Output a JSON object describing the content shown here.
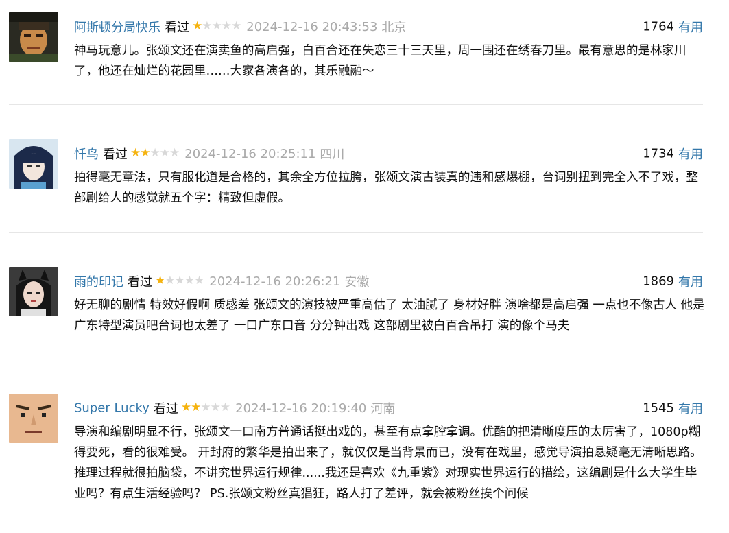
{
  "comments": [
    {
      "username": "阿斯顿分局快乐",
      "status": "看过",
      "rating": 1,
      "time": "2024-12-16 20:43:53",
      "location": "北京",
      "votes": "1764",
      "vote_label": "有用",
      "text": "神马玩意儿。张颂文还在演卖鱼的高启强，白百合还在失恋三十三天里，周一围还在绣春刀里。最有意思的是林家川了，他还在灿烂的花园里……大家各演各的，其乐融融～"
    },
    {
      "username": "忏鸟",
      "status": "看过",
      "rating": 2,
      "time": "2024-12-16 20:25:11",
      "location": "四川",
      "votes": "1734",
      "vote_label": "有用",
      "text": "拍得毫无章法，只有服化道是合格的，其余全方位拉胯，张颂文演古装真的违和感爆棚，台词别扭到完全入不了戏，整部剧给人的感觉就五个字：精致但虚假。"
    },
    {
      "username": "雨的印记",
      "status": "看过",
      "rating": 1,
      "time": "2024-12-16 20:26:21",
      "location": "安徽",
      "votes": "1869",
      "vote_label": "有用",
      "text": "好无聊的剧情 特效好假啊 质感差 张颂文的演技被严重高估了 太油腻了 身材好胖 演啥都是高启强 一点也不像古人 他是广东特型演员吧台词也太差了 一口广东口音 分分钟出戏 这部剧里被白百合吊打 演的像个马夫"
    },
    {
      "username": "Super Lucky",
      "status": "看过",
      "rating": 2,
      "time": "2024-12-16 20:19:40",
      "location": "河南",
      "votes": "1545",
      "vote_label": "有用",
      "text": "导演和编剧明显不行，张颂文一口南方普通话挺出戏的，甚至有点拿腔拿调。优酷的把清晰度压的太厉害了，1080p糊得要死，看的很难受。 开封府的繁华是拍出来了，就仅仅是当背景而已，没有在戏里，感觉导演拍悬疑毫无清晰思路。推理过程就很拍脑袋，不讲究世界运行规律......我还是喜欢《九重紫》对现实世界运行的描绘，这编剧是什么大学生毕业吗？有点生活经验吗？ PS.张颂文粉丝真猖狂，路人打了差评，就会被粉丝挨个问候"
    }
  ],
  "colors": {
    "link": "#3377aa",
    "star_on": "#f5b30f",
    "star_off": "#d8d8d8",
    "meta": "#aaaaaa"
  }
}
